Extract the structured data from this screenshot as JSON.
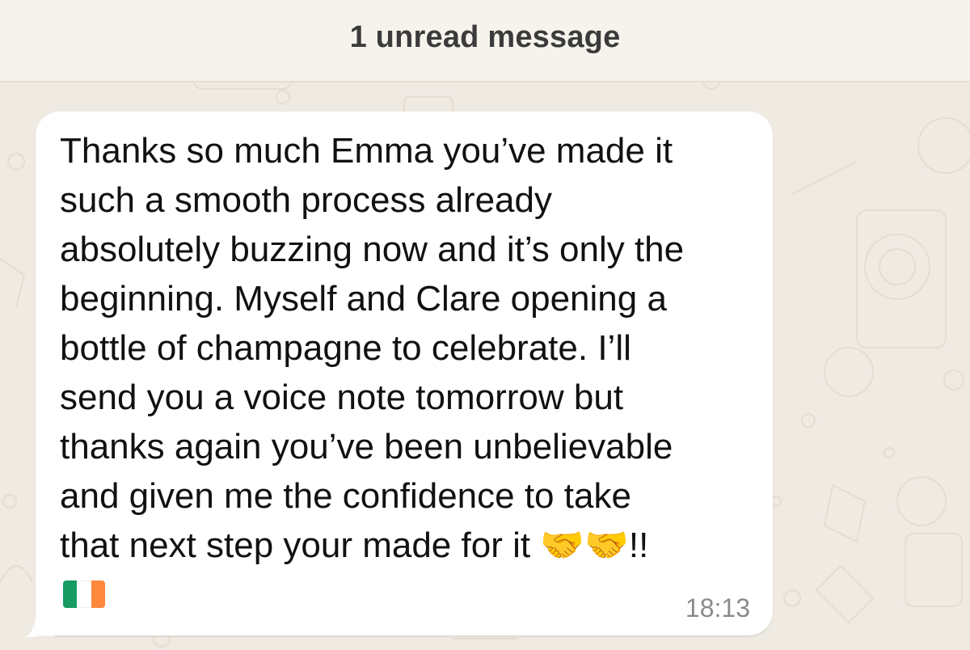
{
  "banner": {
    "label": "1 unread message"
  },
  "message": {
    "text": "Thanks so much Emma you’ve made it\nsuch a smooth process already\nabsolutely buzzing now and it’s only the\nbeginning. Myself and Clare opening a\nbottle of champagne to celebrate. I’ll\nsend you a voice note tomorrow but\nthanks again you’ve been unbelievable\nand given me the confidence to take\nthat next step your made for it 🤝🤝!!",
    "emoji_icons": [
      "handshake-icon",
      "handshake-icon"
    ],
    "flag_icon": "ireland-flag-icon",
    "time": "18:13"
  },
  "colors": {
    "background": "#efeae2",
    "bubble": "#ffffff",
    "flag_green": "#169b62",
    "flag_white": "#ffffff",
    "flag_orange": "#ff883e"
  }
}
